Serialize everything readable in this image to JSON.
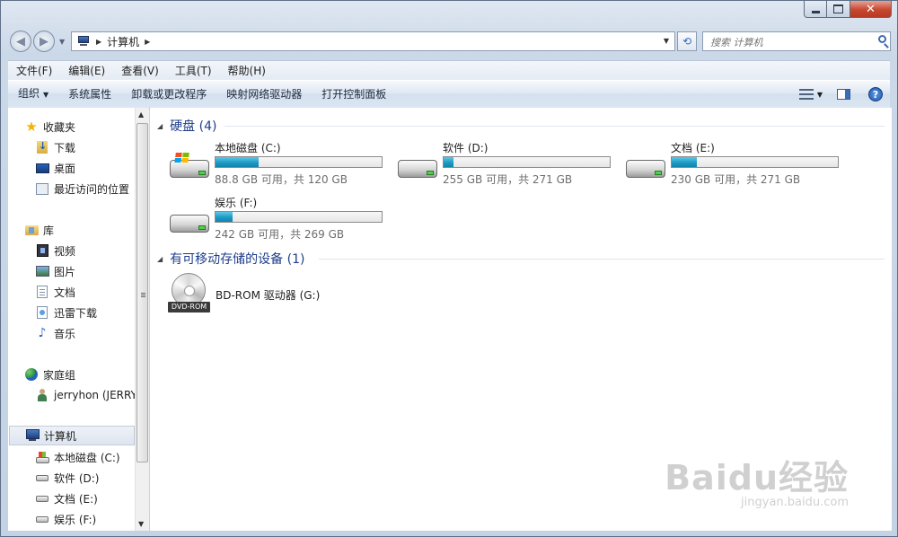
{
  "window": {
    "title": "计算机"
  },
  "address": {
    "location": "计算机",
    "search_placeholder": "搜索 计算机"
  },
  "menu": [
    "文件(F)",
    "编辑(E)",
    "查看(V)",
    "工具(T)",
    "帮助(H)"
  ],
  "commands": {
    "organize": "组织",
    "items": [
      "系统属性",
      "卸载或更改程序",
      "映射网络驱动器",
      "打开控制面板"
    ]
  },
  "sidebar": {
    "favorites": {
      "label": "收藏夹",
      "items": [
        "下载",
        "桌面",
        "最近访问的位置"
      ]
    },
    "libraries": {
      "label": "库",
      "items": [
        "视频",
        "图片",
        "文档",
        "迅雷下载",
        "音乐"
      ]
    },
    "homegroup": {
      "label": "家庭组",
      "items": [
        "jerryhon (JERRY"
      ]
    },
    "computer": {
      "label": "计算机",
      "items": [
        "本地磁盘 (C:)",
        "软件 (D:)",
        "文档 (E:)",
        "娱乐 (F:)"
      ]
    }
  },
  "hard_drives": {
    "header": "硬盘 (4)",
    "drives": [
      {
        "name": "本地磁盘 (C:)",
        "space": "88.8 GB 可用，共 120 GB",
        "used_fraction": 0.26,
        "system": true
      },
      {
        "name": "软件 (D:)",
        "space": "255 GB 可用，共 271 GB",
        "used_fraction": 0.06,
        "system": false
      },
      {
        "name": "文档 (E:)",
        "space": "230 GB 可用，共 271 GB",
        "used_fraction": 0.15,
        "system": false
      },
      {
        "name": "娱乐 (F:)",
        "space": "242 GB 可用，共 269 GB",
        "used_fraction": 0.1,
        "system": false
      }
    ]
  },
  "removable": {
    "header": "有可移动存储的设备 (1)",
    "devices": [
      {
        "name": "BD-ROM 驱动器 (G:)",
        "badge": "DVD-ROM"
      }
    ]
  },
  "watermark": {
    "main": "Baidu经验",
    "sub": "jingyan.baidu.com"
  }
}
